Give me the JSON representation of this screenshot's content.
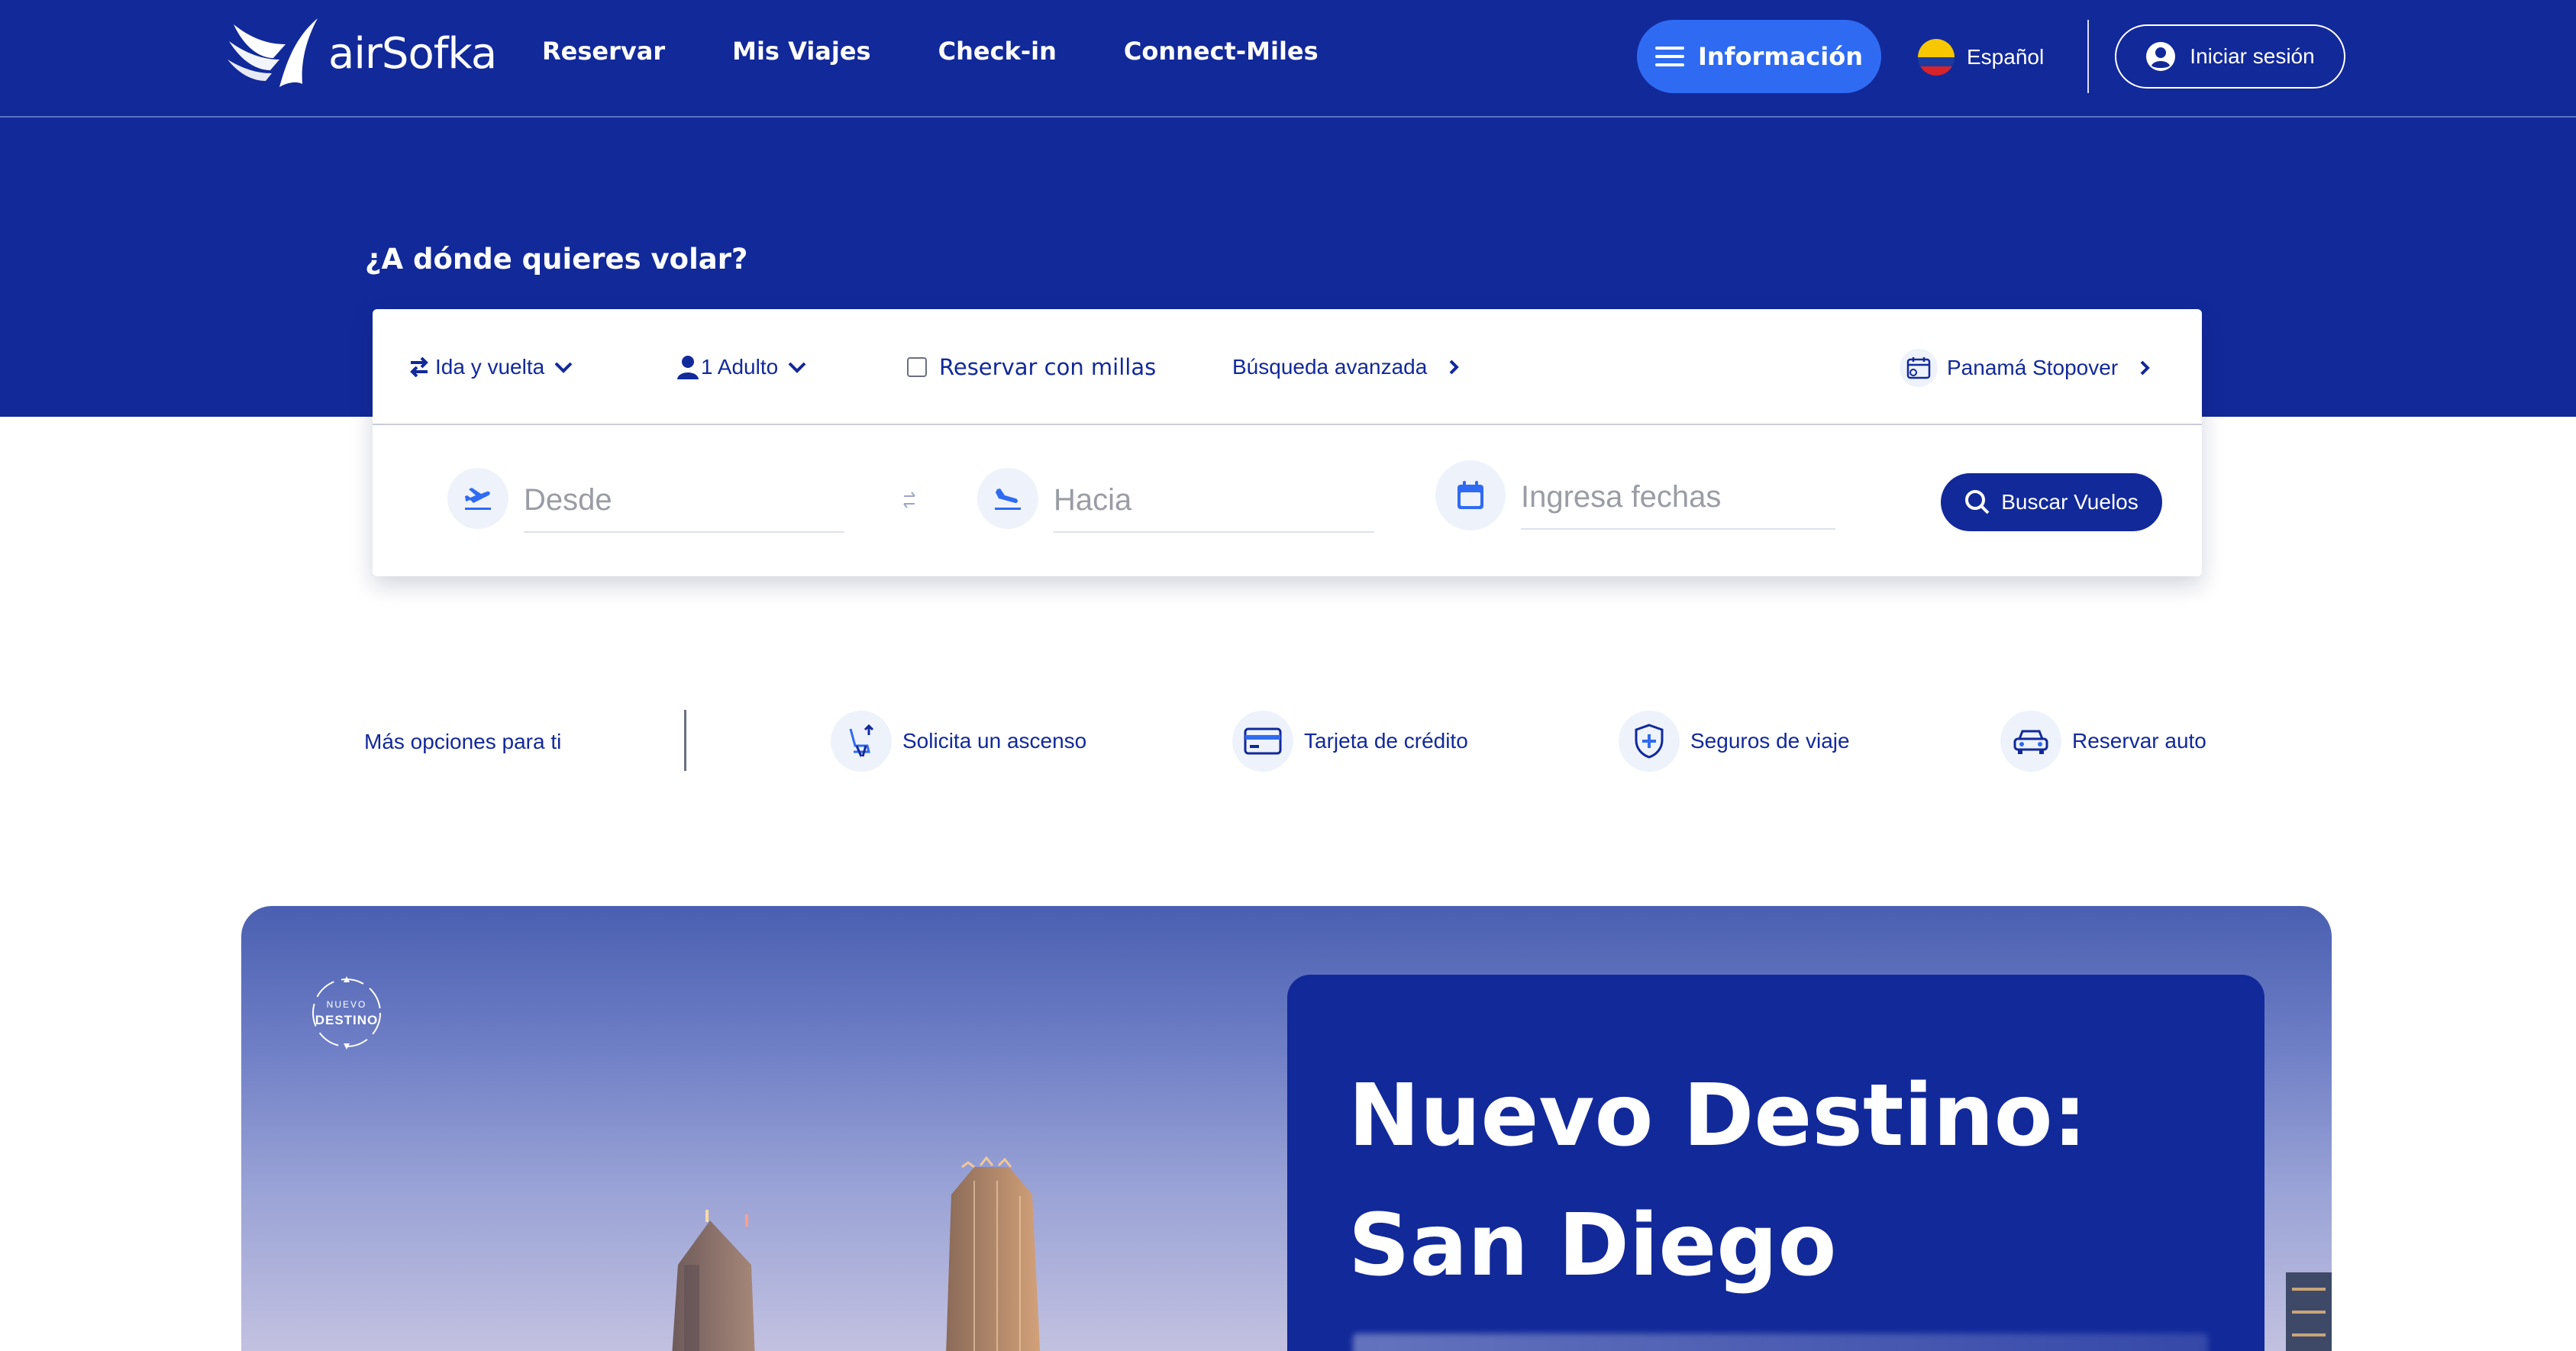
{
  "header": {
    "logo_text": "airSofka",
    "nav": [
      "Reservar",
      "Mis Viajes",
      "Check-in",
      "Connect-Miles"
    ],
    "info_button": "Información",
    "language": "Español",
    "login": "Iniciar sesión"
  },
  "search": {
    "heading": "¿A dónde quieres volar?",
    "trip_type": "Ida y vuelta",
    "passengers": "1 Adulto",
    "miles_checkbox": "Reservar con millas",
    "advanced": "Búsqueda avanzada",
    "stopover": "Panamá Stopover",
    "from_placeholder": "Desde",
    "to_placeholder": "Hacia",
    "dates_placeholder": "Ingresa fechas",
    "search_button": "Buscar Vuelos"
  },
  "more_options": {
    "label": "Más opciones para ti",
    "items": [
      {
        "label": "Solicita un ascenso",
        "icon": "seat-upgrade-icon"
      },
      {
        "label": "Tarjeta de crédito",
        "icon": "credit-card-icon"
      },
      {
        "label": "Seguros de viaje",
        "icon": "shield-plus-icon"
      },
      {
        "label": "Reservar auto",
        "icon": "car-icon"
      }
    ]
  },
  "hero": {
    "badge_top": "NUEVO",
    "badge_bottom": "DESTINO",
    "title_line1": "Nuevo Destino:",
    "title_line2": "San Diego"
  },
  "colors": {
    "brand_blue": "#12299a",
    "accent_blue": "#2f6bf2",
    "icon_bg": "#eef2fb"
  }
}
